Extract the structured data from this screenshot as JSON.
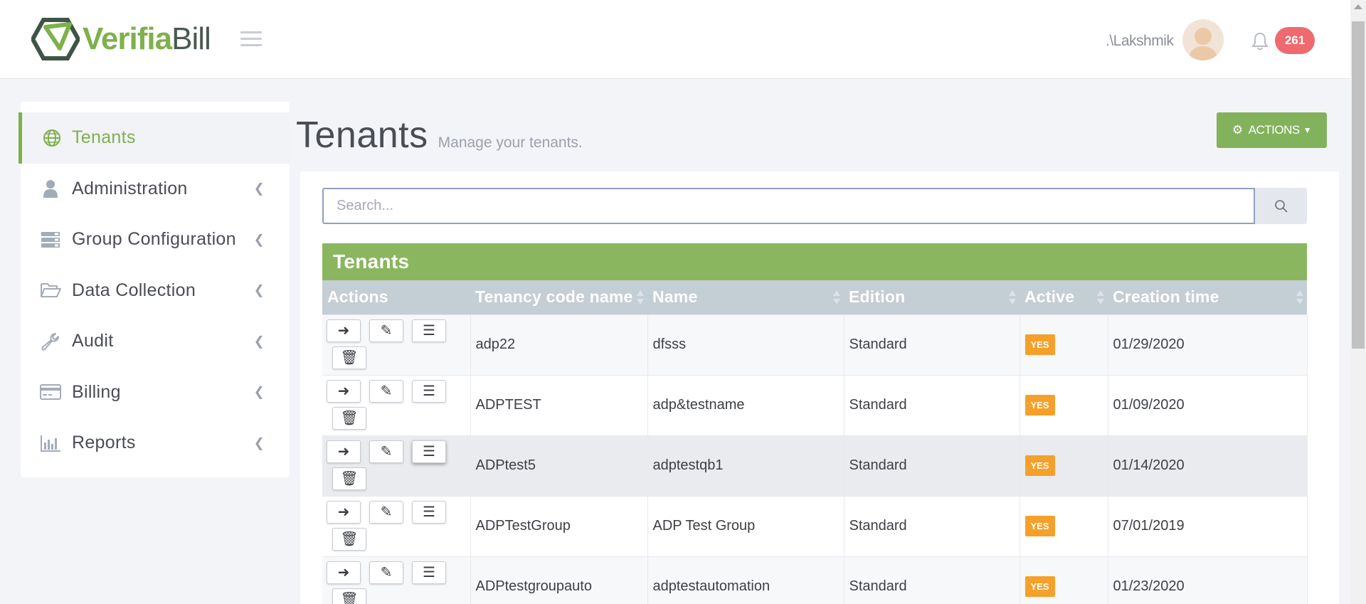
{
  "brand": {
    "logo_part1": "Verifia",
    "logo_part2": "Bill",
    "accent": "#7fb04c"
  },
  "header": {
    "user": ".\\Lakshmik",
    "notification_count": "261"
  },
  "sidebar": {
    "items": [
      {
        "label": "Tenants",
        "icon": "globe-icon",
        "active": true
      },
      {
        "label": "Administration",
        "icon": "user-icon"
      },
      {
        "label": "Group Configuration",
        "icon": "server-icon"
      },
      {
        "label": "Data Collection",
        "icon": "folder-open-icon"
      },
      {
        "label": "Audit",
        "icon": "wrench-icon"
      },
      {
        "label": "Billing",
        "icon": "credit-card-icon"
      },
      {
        "label": "Reports",
        "icon": "bar-chart-icon"
      }
    ]
  },
  "page": {
    "title": "Tenants",
    "subtitle": "Manage your tenants.",
    "actions_label": "ACTIONS"
  },
  "search": {
    "placeholder": "Search..."
  },
  "table": {
    "title": "Tenants",
    "columns": [
      "Actions",
      "Tenancy code name",
      "Name",
      "Edition",
      "Active",
      "Creation time"
    ],
    "rows": [
      {
        "code": "adp22",
        "name": "dfsss",
        "edition": "Standard",
        "active": "YES",
        "created": "01/29/2020"
      },
      {
        "code": "ADPTEST",
        "name": "adp&testname",
        "edition": "Standard",
        "active": "YES",
        "created": "01/09/2020"
      },
      {
        "code": "ADPtest5",
        "name": "adptestqb1",
        "edition": "Standard",
        "active": "YES",
        "created": "01/14/2020"
      },
      {
        "code": "ADPTestGroup",
        "name": "ADP Test Group",
        "edition": "Standard",
        "active": "YES",
        "created": "07/01/2019"
      },
      {
        "code": "ADPtestgroupauto",
        "name": "adptestautomation",
        "edition": "Standard",
        "active": "YES",
        "created": "01/23/2020"
      }
    ]
  }
}
